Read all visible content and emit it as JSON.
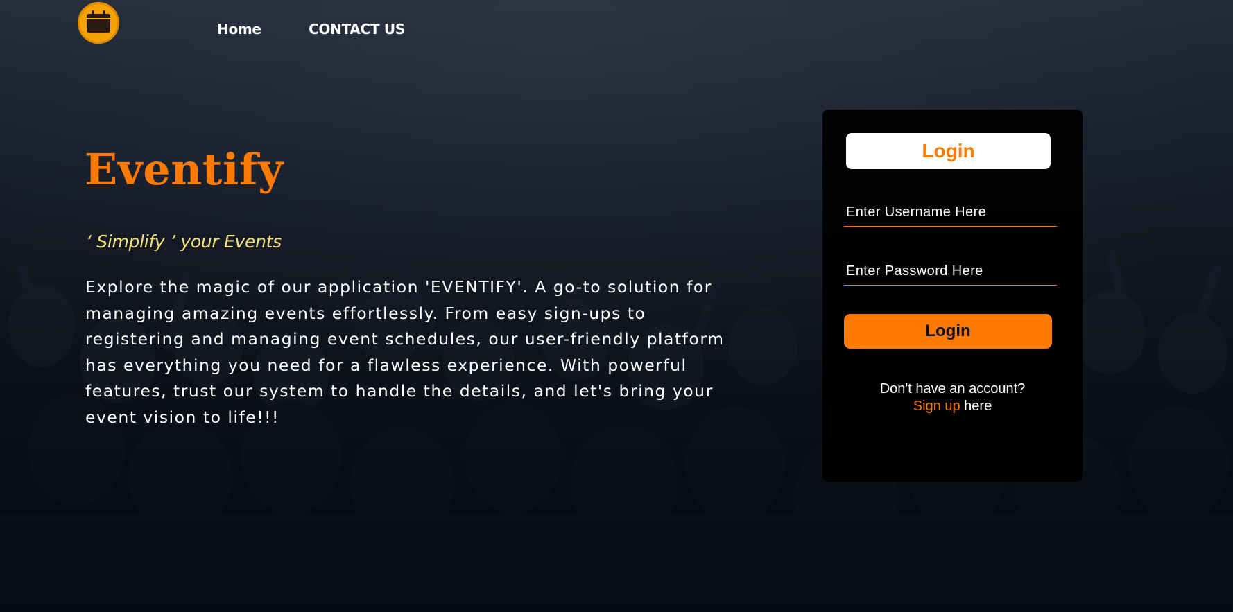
{
  "nav": {
    "links": [
      {
        "label": "Home"
      },
      {
        "label": "CONTACT US"
      }
    ]
  },
  "hero": {
    "title": "Eventify",
    "tagline": "‘ Simplify ’ your Events",
    "description": "Explore the magic of our application 'EVENTIFY'. A go-to solution for managing amazing events effortlessly. From easy sign-ups to registering and managing event schedules, our user-friendly platform has everything you need for a flawless experience. With powerful features, trust our system to handle the details, and let's bring your event vision to life!!!"
  },
  "login": {
    "header": "Login",
    "username_placeholder": "Enter Username Here",
    "password_placeholder": "Enter Password Here",
    "button_label": "Login",
    "no_account_text": "Don't have an account?",
    "signup_link": "Sign up",
    "signup_suffix": " here"
  },
  "colors": {
    "accent": "#ff7a00",
    "tagline": "#f3e27a",
    "logo": "#f5a300"
  },
  "icons": {
    "logo": "calendar-icon"
  }
}
